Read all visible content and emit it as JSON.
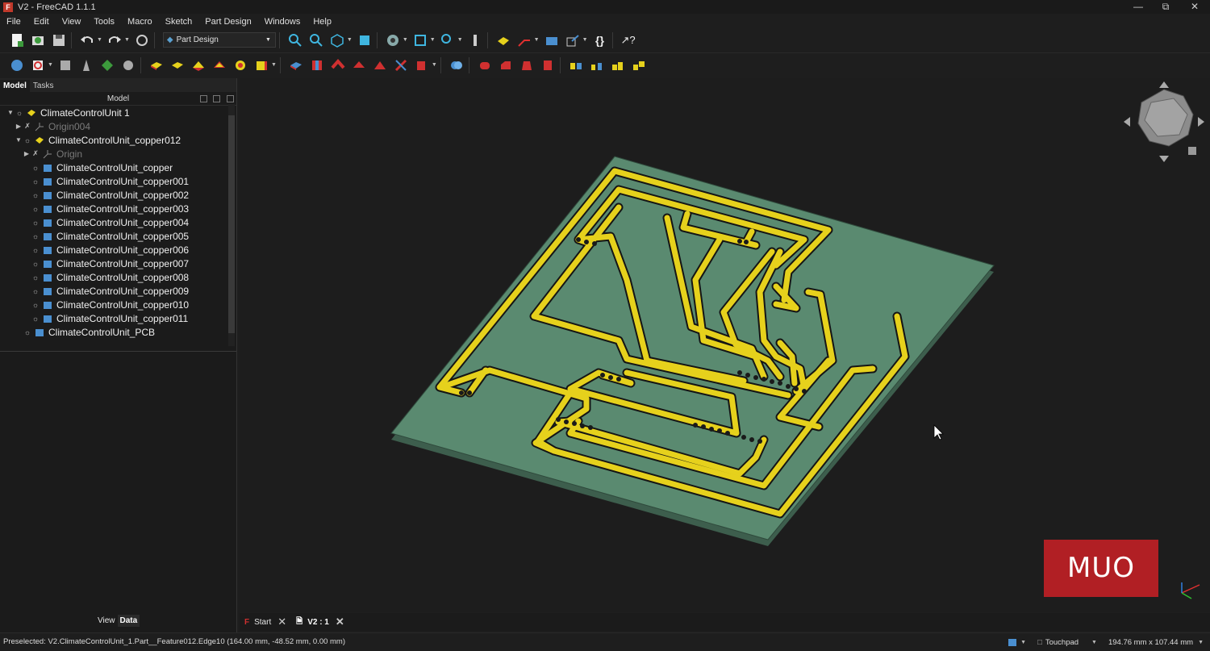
{
  "window": {
    "title": "V2 - FreeCAD 1.1.1"
  },
  "menu": [
    "File",
    "Edit",
    "View",
    "Tools",
    "Macro",
    "Sketch",
    "Part Design",
    "Windows",
    "Help"
  ],
  "toolbar": {
    "workbench": "Part Design"
  },
  "left_tabs": [
    "Model",
    "Tasks"
  ],
  "tree": {
    "header": "Model",
    "items": [
      {
        "label": "ClimateControlUnit 1",
        "icon": "body-icon"
      },
      {
        "label": "Origin004",
        "icon": "origin-icon"
      },
      {
        "label": "ClimateControlUnit_copper012",
        "icon": "body-icon"
      },
      {
        "label": "Origin",
        "icon": "origin-icon"
      },
      {
        "label": "ClimateControlUnit_copper",
        "icon": "feature-icon"
      },
      {
        "label": "ClimateControlUnit_copper001",
        "icon": "feature-icon"
      },
      {
        "label": "ClimateControlUnit_copper002",
        "icon": "feature-icon"
      },
      {
        "label": "ClimateControlUnit_copper003",
        "icon": "feature-icon"
      },
      {
        "label": "ClimateControlUnit_copper004",
        "icon": "feature-icon"
      },
      {
        "label": "ClimateControlUnit_copper005",
        "icon": "feature-icon"
      },
      {
        "label": "ClimateControlUnit_copper006",
        "icon": "feature-icon"
      },
      {
        "label": "ClimateControlUnit_copper007",
        "icon": "feature-icon"
      },
      {
        "label": "ClimateControlUnit_copper008",
        "icon": "feature-icon"
      },
      {
        "label": "ClimateControlUnit_copper009",
        "icon": "feature-icon"
      },
      {
        "label": "ClimateControlUnit_copper010",
        "icon": "feature-icon"
      },
      {
        "label": "ClimateControlUnit_copper011",
        "icon": "feature-icon"
      },
      {
        "label": "ClimateControlUnit_PCB",
        "icon": "feature-icon"
      }
    ]
  },
  "prop_tabs": [
    "View",
    "Data"
  ],
  "doc_tabs": [
    {
      "label": "Start"
    },
    {
      "label": "V2 : 1"
    }
  ],
  "status": {
    "message": "Preselected: V2.ClimateControlUnit_1.Part__Feature012.Edge10 (164.00 mm, -48.52 mm, 0.00 mm)",
    "nav": "Touchpad",
    "dimensions": "194.76 mm x 107.44 mm"
  },
  "watermark": "MUO",
  "colors": {
    "pcb": "#5a8a70",
    "copper": "#e6d11c",
    "background": "#1d1d1d",
    "accent": "#b11f24"
  }
}
